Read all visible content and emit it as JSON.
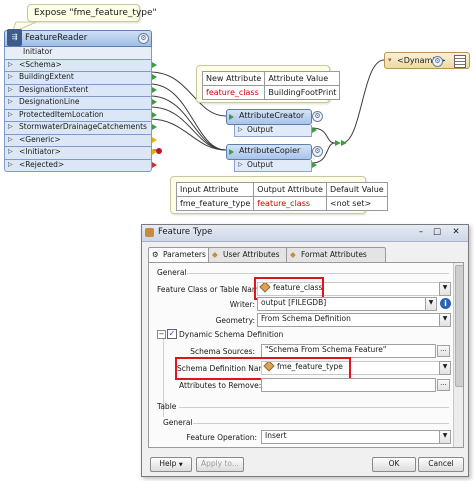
{
  "canvas": {
    "bubble_title": "Expose \"fme_feature_type\"",
    "feature_reader": {
      "title": "FeatureReader",
      "initiator": "Initiator",
      "ports": [
        "<Schema>",
        "BuildingExtent",
        "DesignationExtent",
        "DesignationLine",
        "ProtectedItemLocation",
        "StormwaterDrainageCatchements",
        "<Generic>",
        "<Initiator>",
        "<Rejected>"
      ]
    },
    "attribute_creator": {
      "title": "AttributeCreator",
      "port": "Output"
    },
    "attribute_copier": {
      "title": "AttributeCopier",
      "port": "Output"
    },
    "writer": {
      "label": "<Dynamic>"
    },
    "creator_table": {
      "headers": [
        "New Attribute",
        "Attribute Value"
      ],
      "row": [
        "feature_class",
        "BuildingFootPrint"
      ]
    },
    "copier_table": {
      "headers": [
        "Input Attribute",
        "Output Attribute",
        "Default Value"
      ],
      "row": [
        "fme_feature_type",
        "feature_class",
        "<not set>"
      ]
    },
    "colors": {
      "wire": "#3c3c3c",
      "port_green": "#3f9b3f",
      "highlight": "#e0141e",
      "accent_red": "#d40000"
    }
  },
  "dialog": {
    "title": "Feature Type",
    "window_buttons": {
      "minimize": "–",
      "maximize": "□",
      "close": "✕"
    },
    "tabs": [
      "Parameters",
      "User Attributes",
      "Format Attributes"
    ],
    "general_section": "General",
    "fields": {
      "feature_class_label": "Feature Class or Table Name:",
      "feature_class_value": "feature_class",
      "writer_label": "Writer:",
      "writer_value": "output [FILEGDB]",
      "geometry_label": "Geometry:",
      "geometry_value": "From Schema Definition",
      "dynamic_schema_label": "Dynamic Schema Definition",
      "schema_sources_label": "Schema Sources:",
      "schema_sources_value": "\"Schema From Schema Feature\"",
      "schema_def_label": "Schema Definition Name:",
      "schema_def_value": "fme_feature_type",
      "attrs_remove_label": "Attributes to Remove:",
      "attrs_remove_value": ""
    },
    "table_section": "Table",
    "table_general": "General",
    "feature_operation_label": "Feature Operation:",
    "feature_operation_value": "Insert",
    "buttons": {
      "help": "Help",
      "apply": "Apply to...",
      "ok": "OK",
      "cancel": "Cancel"
    },
    "glyphs": {
      "dropdown": "▼",
      "dots": "...",
      "info": "i",
      "check": "✓",
      "minus": "−"
    }
  }
}
